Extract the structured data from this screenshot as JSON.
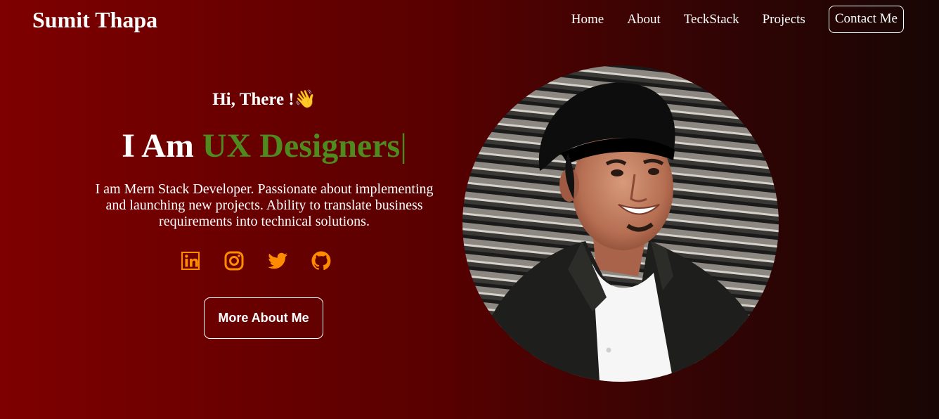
{
  "nav": {
    "brand": "Sumit Thapa",
    "links": [
      {
        "label": "Home"
      },
      {
        "label": "About"
      },
      {
        "label": "TeckStack"
      },
      {
        "label": "Projects"
      },
      {
        "label": "Contact Me"
      }
    ]
  },
  "hero": {
    "greeting": "Hi, There !",
    "greeting_emoji": "👋",
    "headline_prefix": "I Am ",
    "headline_role": "UX Designers",
    "cursor": "|",
    "bio": "I am Mern Stack Developer. Passionate about implementing and launching new projects. Ability to translate business requirements into technical solutions.",
    "cta": "More About Me",
    "socials": [
      {
        "icon": "linkedin-icon"
      },
      {
        "icon": "instagram-icon"
      },
      {
        "icon": "twitter-icon"
      },
      {
        "icon": "github-icon"
      }
    ]
  },
  "colors": {
    "accent_role": "#4e8a1e",
    "social_icons": "#ff8c00",
    "background_start": "#7e0000",
    "background_end": "#180604"
  }
}
